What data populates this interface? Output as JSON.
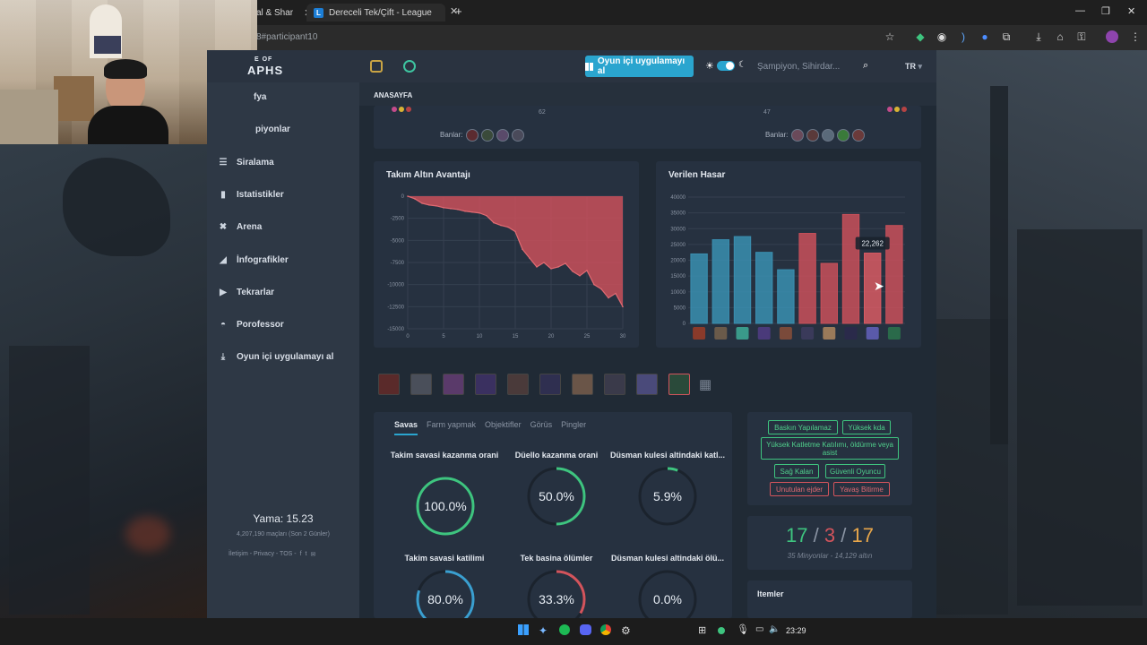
{
  "browser": {
    "tabs": [
      {
        "label": "al & Shar"
      },
      {
        "label": "Dereceli Tek/Çift - LeagueOfGra"
      }
    ],
    "url": "8#participant10"
  },
  "site": {
    "logo_line1": "E OF",
    "logo_line2": "APHS",
    "cta_label": "Oyun içi uygulamayı al",
    "search_placeholder": "Şampiyon, Sihirdar...",
    "lang": "TR",
    "breadcrumb": "ANASAYFA"
  },
  "sidebar": {
    "items": [
      {
        "label": "fya",
        "icon": "home-icon"
      },
      {
        "label": "piyonlar",
        "icon": "champions-icon"
      },
      {
        "label": "Siralama",
        "icon": "list-icon"
      },
      {
        "label": "Istatistikler",
        "icon": "bar-chart-icon"
      },
      {
        "label": "Arena",
        "icon": "arena-icon"
      },
      {
        "label": "İnfografikler",
        "icon": "infographic-icon"
      },
      {
        "label": "Tekrarlar",
        "icon": "play-icon"
      },
      {
        "label": "Porofessor",
        "icon": "porofessor-icon"
      },
      {
        "label": "Oyun içi uygulamayı al",
        "icon": "download-icon"
      }
    ],
    "patch": "Yama: 15.23",
    "matches": "4,207,190 maçları (Son 2 Günler)",
    "footer": "İletişim - Privacy - TOS -"
  },
  "top_strip": {
    "left_num": "62",
    "right_num": "47",
    "bans_label_left": "Banlar:",
    "bans_label_right": "Banlar:"
  },
  "gold_chart": {
    "title": "Takım Altın Avantajı",
    "chart_data": {
      "type": "area",
      "x": [
        0,
        1,
        2,
        3,
        4,
        5,
        6,
        7,
        8,
        9,
        10,
        11,
        12,
        13,
        14,
        15,
        16,
        17,
        18,
        19,
        20,
        21,
        22,
        23,
        24,
        25,
        26,
        27,
        28,
        29,
        30
      ],
      "y": [
        0,
        -300,
        -800,
        -1000,
        -1100,
        -1300,
        -1400,
        -1500,
        -1700,
        -1800,
        -1900,
        -2200,
        -3000,
        -3300,
        -3500,
        -4000,
        -6000,
        -7000,
        -8000,
        -7500,
        -8200,
        -8000,
        -7600,
        -8500,
        -9000,
        -8400,
        -10000,
        -10500,
        -11500,
        -11000,
        -12500
      ],
      "xticks": [
        "0",
        "5",
        "10",
        "15",
        "20",
        "25",
        "30"
      ],
      "yticks": [
        "0",
        "-2500",
        "-5000",
        "-7500",
        "-10000",
        "-12500",
        "-15000"
      ],
      "ylim": [
        -15000,
        0
      ],
      "xlim": [
        0,
        30
      ],
      "color": "#c9505a"
    }
  },
  "damage_chart": {
    "title": "Verilen Hasar",
    "tooltip": "22,262",
    "chart_data": {
      "type": "bar",
      "values": [
        22000,
        26500,
        27500,
        22500,
        17000,
        28500,
        19000,
        34500,
        22262,
        31000
      ],
      "colors": [
        "#3a8fb0",
        "#3a8fb0",
        "#3a8fb0",
        "#3a8fb0",
        "#3a8fb0",
        "#c9505a",
        "#c9505a",
        "#c9505a",
        "#d85a63",
        "#c9505a"
      ],
      "yticks": [
        "0",
        "5000",
        "10000",
        "15000",
        "20000",
        "25000",
        "30000",
        "35000",
        "40000"
      ],
      "ylim": [
        0,
        40000
      ]
    }
  },
  "stats": {
    "tabs": [
      "Savas",
      "Farm yapmak",
      "Objektifler",
      "Görüs",
      "Pingler"
    ],
    "items": [
      {
        "title": "Takim savasi kazanma orani",
        "value": "100.0%",
        "pct": 1.0,
        "color": "#3ec47f"
      },
      {
        "title": "Düello kazanma orani",
        "value": "50.0%",
        "pct": 0.5,
        "color": "#3ec47f"
      },
      {
        "title": "Düsman kulesi altindaki katl...",
        "value": "5.9%",
        "pct": 0.059,
        "color": "#3ec47f"
      },
      {
        "title": "Takim savasi katilimi",
        "value": "80.0%",
        "pct": 0.8,
        "color": "#3a9fd0"
      },
      {
        "title": "Tek basina ölümler",
        "value": "33.3%",
        "pct": 0.333,
        "color": "#d3545c"
      },
      {
        "title": "Düsman kulesi altindaki ölü...",
        "value": "0.0%",
        "pct": 0.0,
        "color": "#3ec47f"
      }
    ]
  },
  "badges": {
    "row1": [
      "Baskın Yapılamaz",
      "Yüksek kda"
    ],
    "row2": "Yüksek Katletme Katılımı, öldürme veya asist",
    "row3": [
      "Sağ Kalan",
      "Güvenli Oyuncu"
    ],
    "row4": [
      "Unutulan ejder",
      "Yavaş Bitirme"
    ]
  },
  "kda": {
    "kills": "17",
    "deaths": "3",
    "assists": "17",
    "sep": "/",
    "sub": "35 Minyonlar - 14,129 altın"
  },
  "items_title": "Itemler",
  "taskbar": {
    "time": "23:29"
  }
}
